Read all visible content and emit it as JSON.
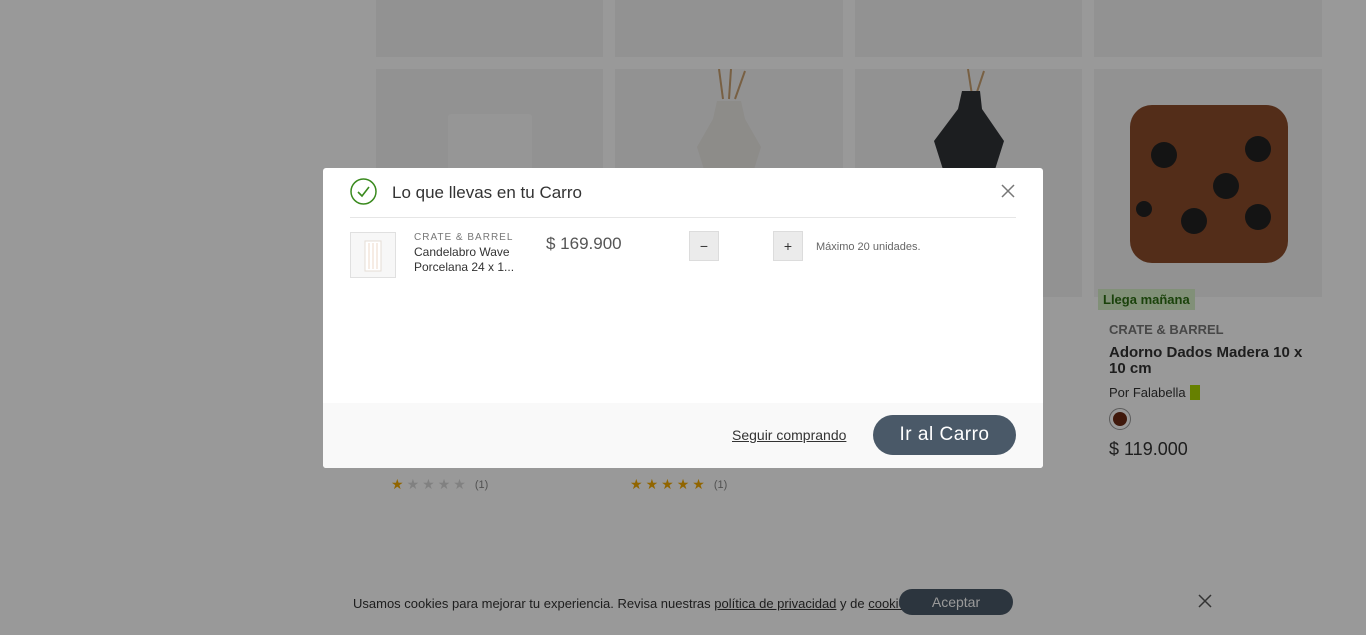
{
  "background": {
    "cards": [
      {
        "rating": {
          "stars_filled": 1,
          "count": "(1)"
        }
      },
      {
        "rating": {
          "stars_filled": 5,
          "count": "(1)"
        }
      },
      {},
      {
        "badge": "Llega mañana",
        "brand": "CRATE & BARREL",
        "title": "Adorno Dados Madera 10 x 10 cm",
        "seller": "Por Falabella",
        "swatch_color": "#6b2a15",
        "price": "$ 119.000"
      }
    ],
    "star_icon": "★"
  },
  "cookie": {
    "text_before": "Usamos cookies para mejorar tu experiencia. Revisa nuestras ",
    "privacy_link": "política de privacidad",
    "text_middle": " y de ",
    "cookies_link": "cookies",
    "text_after": ".",
    "accept_label": "Aceptar",
    "close_icon": "close-icon"
  },
  "modal": {
    "title": "Lo que llevas en tu Carro",
    "item": {
      "brand": "CRATE & BARREL",
      "name": "Candelabro Wave Porcelana 24 x 1...",
      "price": "$ 169.900",
      "minus_label": "−",
      "plus_label": "+",
      "max_note": "Máximo 20 unidades."
    },
    "continue_label": "Seguir comprando",
    "go_cart_label": "Ir al Carro",
    "accent_color": "#4a5968",
    "check_color": "#3a8a1e"
  }
}
